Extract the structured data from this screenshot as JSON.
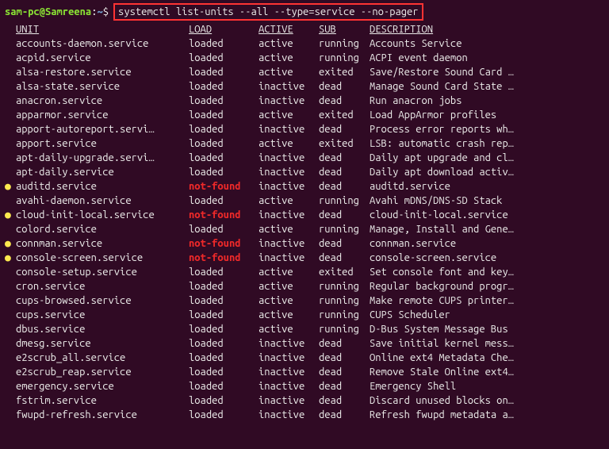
{
  "prompt": {
    "user_host": "sam-pc@Samreena",
    "path": "~",
    "command": "systemctl list-units --all --type=service --no-pager"
  },
  "headers": {
    "unit": "UNIT",
    "load": "LOAD",
    "active": "ACTIVE",
    "sub": "SUB",
    "description": "DESCRIPTION"
  },
  "services": [
    {
      "bullet": "",
      "unit": "accounts-daemon.service",
      "load": "loaded",
      "active": "active",
      "sub": "running",
      "desc": "Accounts Service"
    },
    {
      "bullet": "",
      "unit": "acpid.service",
      "load": "loaded",
      "active": "active",
      "sub": "running",
      "desc": "ACPI event daemon"
    },
    {
      "bullet": "",
      "unit": "alsa-restore.service",
      "load": "loaded",
      "active": "active",
      "sub": "exited",
      "desc": "Save/Restore Sound Card …"
    },
    {
      "bullet": "",
      "unit": "alsa-state.service",
      "load": "loaded",
      "active": "inactive",
      "sub": "dead",
      "desc": "Manage Sound Card State …"
    },
    {
      "bullet": "",
      "unit": "anacron.service",
      "load": "loaded",
      "active": "inactive",
      "sub": "dead",
      "desc": "Run anacron jobs"
    },
    {
      "bullet": "",
      "unit": "apparmor.service",
      "load": "loaded",
      "active": "active",
      "sub": "exited",
      "desc": "Load AppArmor profiles"
    },
    {
      "bullet": "",
      "unit": "apport-autoreport.servi…",
      "load": "loaded",
      "active": "inactive",
      "sub": "dead",
      "desc": "Process error reports wh…"
    },
    {
      "bullet": "",
      "unit": "apport.service",
      "load": "loaded",
      "active": "active",
      "sub": "exited",
      "desc": "LSB: automatic crash rep…"
    },
    {
      "bullet": "",
      "unit": "apt-daily-upgrade.servi…",
      "load": "loaded",
      "active": "inactive",
      "sub": "dead",
      "desc": "Daily apt upgrade and cl…"
    },
    {
      "bullet": "",
      "unit": "apt-daily.service",
      "load": "loaded",
      "active": "inactive",
      "sub": "dead",
      "desc": "Daily apt download activ…"
    },
    {
      "bullet": "●",
      "bulletClass": "yellow",
      "unit": "auditd.service",
      "load": "not-found",
      "active": "inactive",
      "sub": "dead",
      "desc": "auditd.service"
    },
    {
      "bullet": "",
      "unit": "avahi-daemon.service",
      "load": "loaded",
      "active": "active",
      "sub": "running",
      "desc": "Avahi mDNS/DNS-SD Stack"
    },
    {
      "bullet": "●",
      "bulletClass": "yellow",
      "unit": "cloud-init-local.service",
      "load": "not-found",
      "active": "inactive",
      "sub": "dead",
      "desc": "cloud-init-local.service"
    },
    {
      "bullet": "",
      "unit": "colord.service",
      "load": "loaded",
      "active": "active",
      "sub": "running",
      "desc": "Manage, Install and Gene…"
    },
    {
      "bullet": "●",
      "bulletClass": "yellow",
      "unit": "connman.service",
      "load": "not-found",
      "active": "inactive",
      "sub": "dead",
      "desc": "connman.service"
    },
    {
      "bullet": "●",
      "bulletClass": "yellow",
      "unit": "console-screen.service",
      "load": "not-found",
      "active": "inactive",
      "sub": "dead",
      "desc": "console-screen.service"
    },
    {
      "bullet": "",
      "unit": "console-setup.service",
      "load": "loaded",
      "active": "active",
      "sub": "exited",
      "desc": "Set console font and key…"
    },
    {
      "bullet": "",
      "unit": "cron.service",
      "load": "loaded",
      "active": "active",
      "sub": "running",
      "desc": "Regular background progr…"
    },
    {
      "bullet": "",
      "unit": "cups-browsed.service",
      "load": "loaded",
      "active": "active",
      "sub": "running",
      "desc": "Make remote CUPS printer…"
    },
    {
      "bullet": "",
      "unit": "cups.service",
      "load": "loaded",
      "active": "active",
      "sub": "running",
      "desc": "CUPS Scheduler"
    },
    {
      "bullet": "",
      "unit": "dbus.service",
      "load": "loaded",
      "active": "active",
      "sub": "running",
      "desc": "D-Bus System Message Bus"
    },
    {
      "bullet": "",
      "unit": "dmesg.service",
      "load": "loaded",
      "active": "inactive",
      "sub": "dead",
      "desc": "Save initial kernel mess…"
    },
    {
      "bullet": "",
      "unit": "e2scrub_all.service",
      "load": "loaded",
      "active": "inactive",
      "sub": "dead",
      "desc": "Online ext4 Metadata Che…"
    },
    {
      "bullet": "",
      "unit": "e2scrub_reap.service",
      "load": "loaded",
      "active": "inactive",
      "sub": "dead",
      "desc": "Remove Stale Online ext4…"
    },
    {
      "bullet": "",
      "unit": "emergency.service",
      "load": "loaded",
      "active": "inactive",
      "sub": "dead",
      "desc": "Emergency Shell"
    },
    {
      "bullet": "",
      "unit": "fstrim.service",
      "load": "loaded",
      "active": "inactive",
      "sub": "dead",
      "desc": "Discard unused blocks on…"
    },
    {
      "bullet": "",
      "unit": "fwupd-refresh.service",
      "load": "loaded",
      "active": "inactive",
      "sub": "dead",
      "desc": "Refresh fwupd metadata a…"
    }
  ]
}
